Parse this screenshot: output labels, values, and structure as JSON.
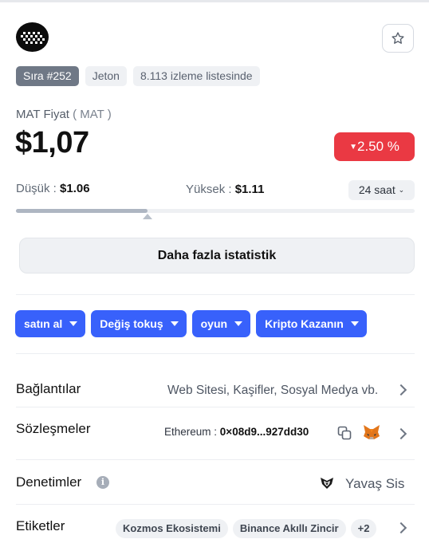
{
  "coin": {
    "rank_badge": "Sıra #252",
    "type_badge": "Jeton",
    "watchlist_badge": "8.113 izleme listesinde",
    "price_label": "MAT Fiyat",
    "symbol_label": "( MAT )",
    "price": "$1,07",
    "change": "2.50 %",
    "change_direction": "down",
    "change_color": "#ea3943"
  },
  "range": {
    "low_label": "Düşük :",
    "low_value": "$1.06",
    "high_label": "Yüksek :",
    "high_value": "$1.11",
    "period": "24 saat",
    "position_fraction": 0.33
  },
  "stats_button": "Daha fazla istatistik",
  "actions": [
    {
      "label": "satın al"
    },
    {
      "label": "Değiş tokuş"
    },
    {
      "label": "oyun"
    },
    {
      "label": "Kripto Kazanın"
    }
  ],
  "accent_color": "#3861fb",
  "rows": {
    "links": {
      "label": "Bağlantılar",
      "value": "Web Sitesi, Kaşifler, Sosyal Medya vb."
    },
    "contracts": {
      "label": "Sözleşmeler",
      "chain": "Ethereum :",
      "address": "0×08d9...927dd30"
    },
    "audits": {
      "label": "Denetimler",
      "auditor": "Yavaş Sis"
    },
    "tags": {
      "label": "Etiketler",
      "items": [
        "Kozmos Ekosistemi",
        "Binance Akıllı Zincir"
      ],
      "more": "+2"
    }
  },
  "icons": {
    "logo": "pixel-grid-logo",
    "star": "star-icon",
    "copy": "copy-icon",
    "wallet": "fox-icon",
    "info": "info-icon",
    "auditor": "slowmist-icon",
    "chevron": "chevron-right-icon"
  }
}
